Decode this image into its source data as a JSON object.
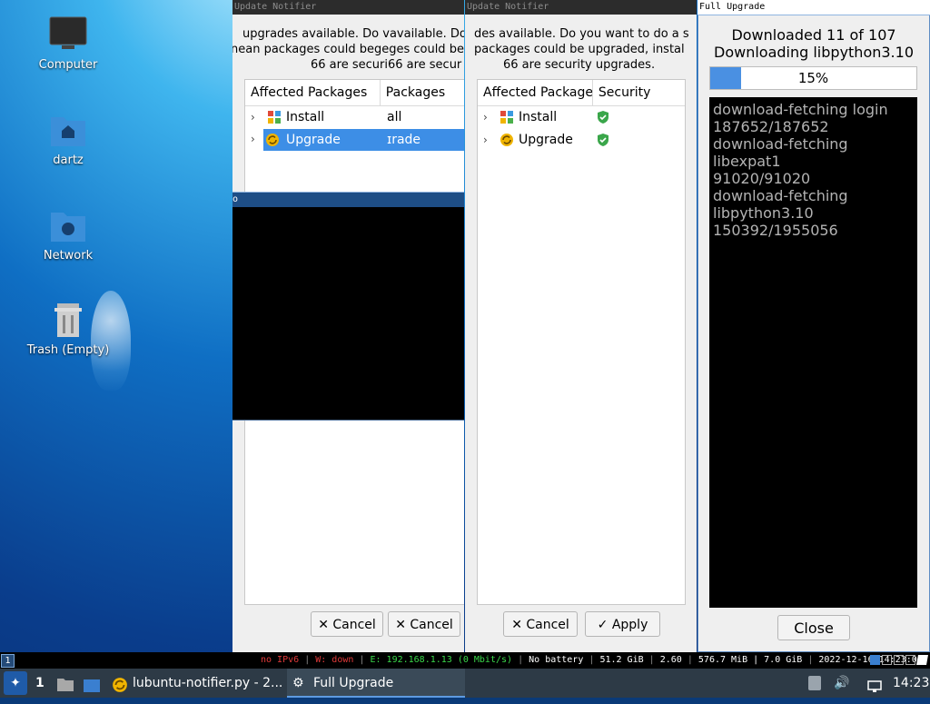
{
  "desktop": {
    "icons": [
      {
        "label": "Computer",
        "icon": "computer-icon"
      },
      {
        "label": "dartz",
        "icon": "home-folder-icon"
      },
      {
        "label": "Network",
        "icon": "network-folder-icon"
      },
      {
        "label": "Trash (Empty)",
        "icon": "trash-icon"
      }
    ]
  },
  "notifier1": {
    "title": "Update Notifier",
    "line1": "upgrades available. Do vavailable. Do",
    "line2": "nean packages could begeges could be",
    "line3": "66 are securi66 are secur",
    "col_packages": "Affected Packages",
    "col_second": "Packages",
    "rows": [
      {
        "label": "Install",
        "extra": "all"
      },
      {
        "label": "Upgrade",
        "extra": "ɪrade"
      }
    ],
    "overlay_title": "o",
    "cancel1": "Cancel",
    "cancel2": "Cancel"
  },
  "notifier2": {
    "title": "Update Notifier",
    "line1": "des available. Do you want to do a s",
    "line2": "packages could be upgraded, instal",
    "line3": "66 are security upgrades.",
    "col_packages": "Affected Package",
    "col_security": "Security",
    "rows": [
      {
        "label": "Install"
      },
      {
        "label": "Upgrade"
      }
    ],
    "cancel": "Cancel",
    "apply": "Apply"
  },
  "full_upgrade": {
    "title": "Full Upgrade",
    "heading1": "Downloaded 11 of 107",
    "heading2": "Downloading libpython3.10",
    "progress_label": "15%",
    "progress": 0.15,
    "log": [
      "download-fetching login",
      "187652/187652",
      "download-fetching",
      "libexpat1",
      "91020/91020",
      "download-fetching",
      "libpython3.10",
      "150392/1955056"
    ],
    "close": "Close"
  },
  "statusbar": {
    "workspace": "1",
    "ipv6": "no IPv6",
    "wifi": "W: down",
    "ethernet": "E: 192.168.1.13 (0 Mbit/s)",
    "battery": "No battery",
    "disk": "51.2 GiB",
    "load": "2.60",
    "mem": "576.7 MiB | 7.0 GiB",
    "datetime": "2022-12-16 14:23:00"
  },
  "taskbar": {
    "workspace": "1",
    "task1": "lubuntu-notifier.py - 2...",
    "task2": "Full Upgrade",
    "clock": "14:23"
  },
  "colors": {
    "selection": "#3d8ee6",
    "progress": "#4a90e2",
    "security": "#3aa64a",
    "taskbar": "#2d3a46"
  }
}
